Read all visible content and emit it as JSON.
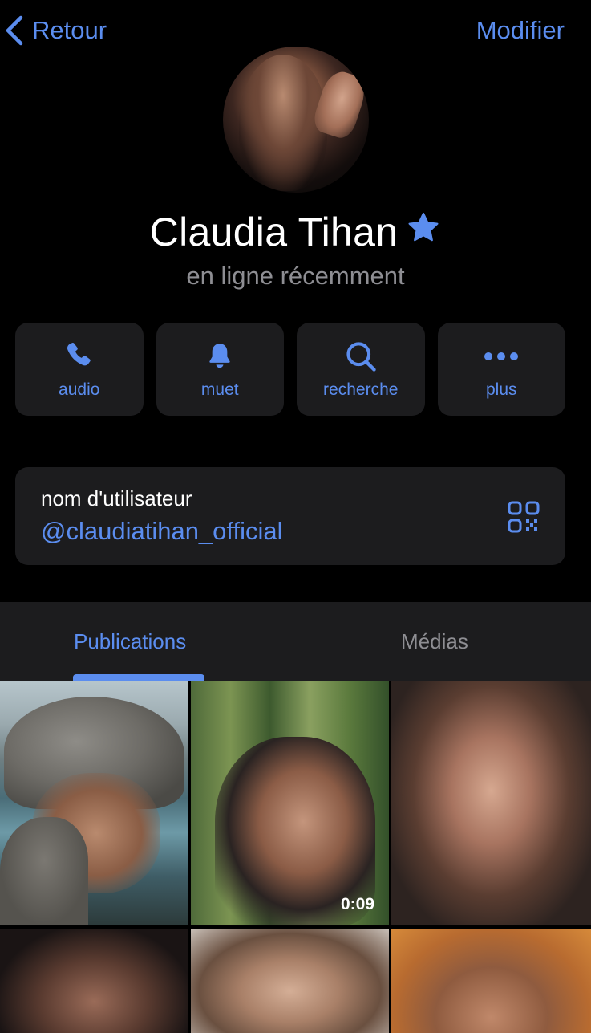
{
  "nav": {
    "back_label": "Retour",
    "edit_label": "Modifier"
  },
  "profile": {
    "name": "Claudia Tihan",
    "status": "en ligne récemment",
    "verified_icon": "star-badge-icon"
  },
  "actions": [
    {
      "label": "audio",
      "icon": "phone-icon"
    },
    {
      "label": "muet",
      "icon": "bell-icon"
    },
    {
      "label": "recherche",
      "icon": "search-icon"
    },
    {
      "label": "plus",
      "icon": "more-dots-icon"
    }
  ],
  "username": {
    "title": "nom d'utilisateur",
    "handle": "@claudiatihan_official",
    "icon": "qr-code-icon"
  },
  "tabs": [
    {
      "label": "Publications",
      "active": true
    },
    {
      "label": "Médias",
      "active": false
    }
  ],
  "media": {
    "video_duration": "0:09"
  },
  "colors": {
    "accent": "#5b8def",
    "background": "#000000",
    "card": "#1c1c1e",
    "secondary_text": "#8e8e93"
  }
}
